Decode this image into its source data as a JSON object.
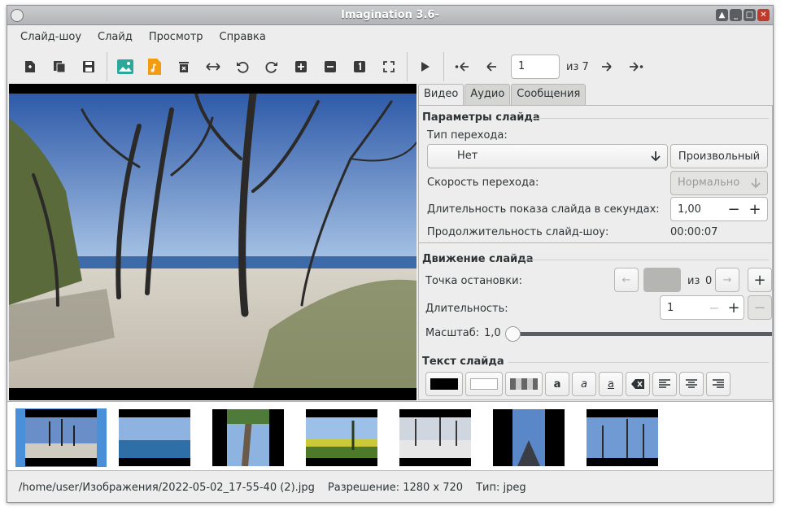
{
  "window": {
    "title": "Imagination 3.6-"
  },
  "menu": [
    "Слайд-шоу",
    "Слайд",
    "Просмотр",
    "Справка"
  ],
  "toolbar": {
    "page_value": "1",
    "page_of": "из 7"
  },
  "tabs": [
    "Видео",
    "Аудио",
    "Сообщения"
  ],
  "slide_params": {
    "section_title": "Параметры слайда",
    "transition_type_label": "Тип перехода:",
    "transition_value": "Нет",
    "random_button": "Произвольный",
    "transition_speed_label": "Скорость перехода:",
    "transition_speed_value": "Нормально",
    "duration_label": "Длительность показа слайда в секундах:",
    "duration_value": "1,00",
    "slideshow_length_label": "Продолжительность слайд-шоу:",
    "slideshow_length_value": "00:00:07"
  },
  "motion": {
    "section_title": "Движение слайда",
    "stop_point_label": "Точка остановки:",
    "of_label": "из",
    "of_value": "0",
    "duration_label": "Длительность:",
    "duration_value": "1",
    "scale_label": "Масштаб:",
    "scale_value": "1,0",
    "scale_fraction": 0.0
  },
  "slide_text": {
    "section_title": "Текст слайда"
  },
  "status": {
    "path": "/home/user/Изображения/2022-05-02_17-55-40 (2).jpg",
    "resolution": "Разрешение: 1280 x 720",
    "type": "Тип: jpeg"
  },
  "colors": {
    "accent": "#4a90d9",
    "close": "#c0392b"
  }
}
